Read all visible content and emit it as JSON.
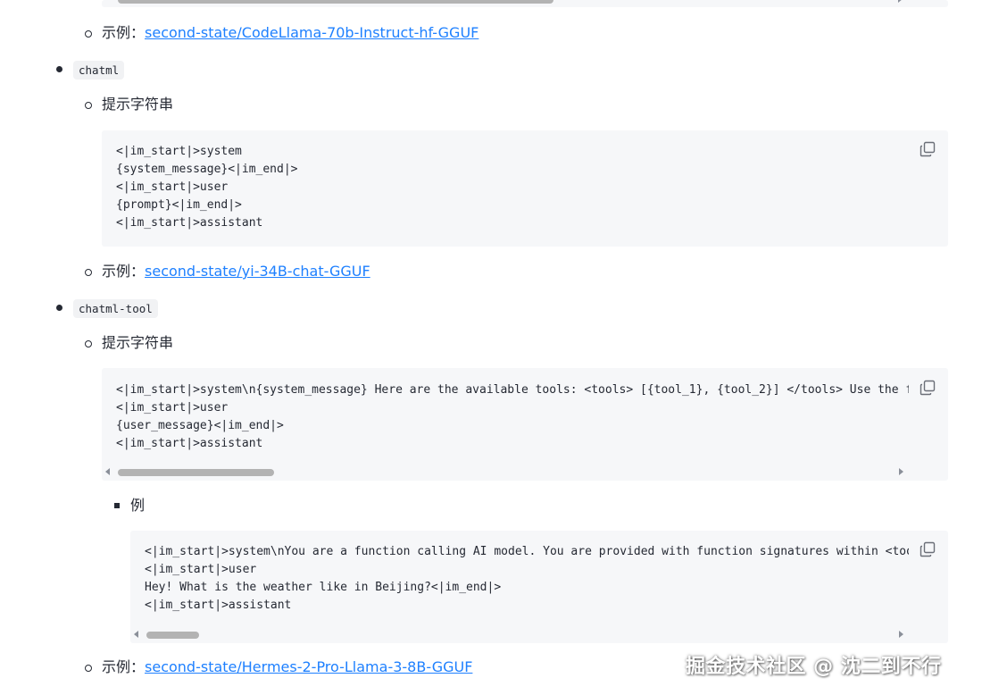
{
  "top_item": {
    "label": "示例：",
    "link": "second-state/CodeLlama-70b-Instruct-hf-GGUF"
  },
  "sections": [
    {
      "name": "chatml",
      "prompt_label": "提示字符串",
      "code": "<|im_start|>system\n{system_message}<|im_end|>\n<|im_start|>user\n{prompt}<|im_end|>\n<|im_start|>assistant",
      "example_label": "示例：",
      "example_link": "second-state/yi-34B-chat-GGUF"
    },
    {
      "name": "chatml-tool",
      "prompt_label": "提示字符串",
      "code": "<|im_start|>system\\n{system_message} Here are the available tools: <tools> [{tool_1}, {tool_2}] </tools> Use the follow\n<|im_start|>user\n{user_message}<|im_end|>\n<|im_start|>assistant",
      "sub_label": "例",
      "sub_code": "<|im_start|>system\\nYou are a function calling AI model. You are provided with function signatures within <tools></\n<|im_start|>user\nHey! What is the weather like in Beijing?<|im_end|>\n<|im_start|>assistant",
      "example_label": "示例：",
      "example_link": "second-state/Hermes-2-Pro-Llama-3-8B-GGUF"
    }
  ],
  "watermark": "掘金技术社区 @ 沈二到不行",
  "icons": {
    "copy": "copy-icon"
  },
  "colors": {
    "link": "#1e80ff",
    "code_bg": "#f6f7f9",
    "inline_code_bg": "#f1f2f4"
  }
}
